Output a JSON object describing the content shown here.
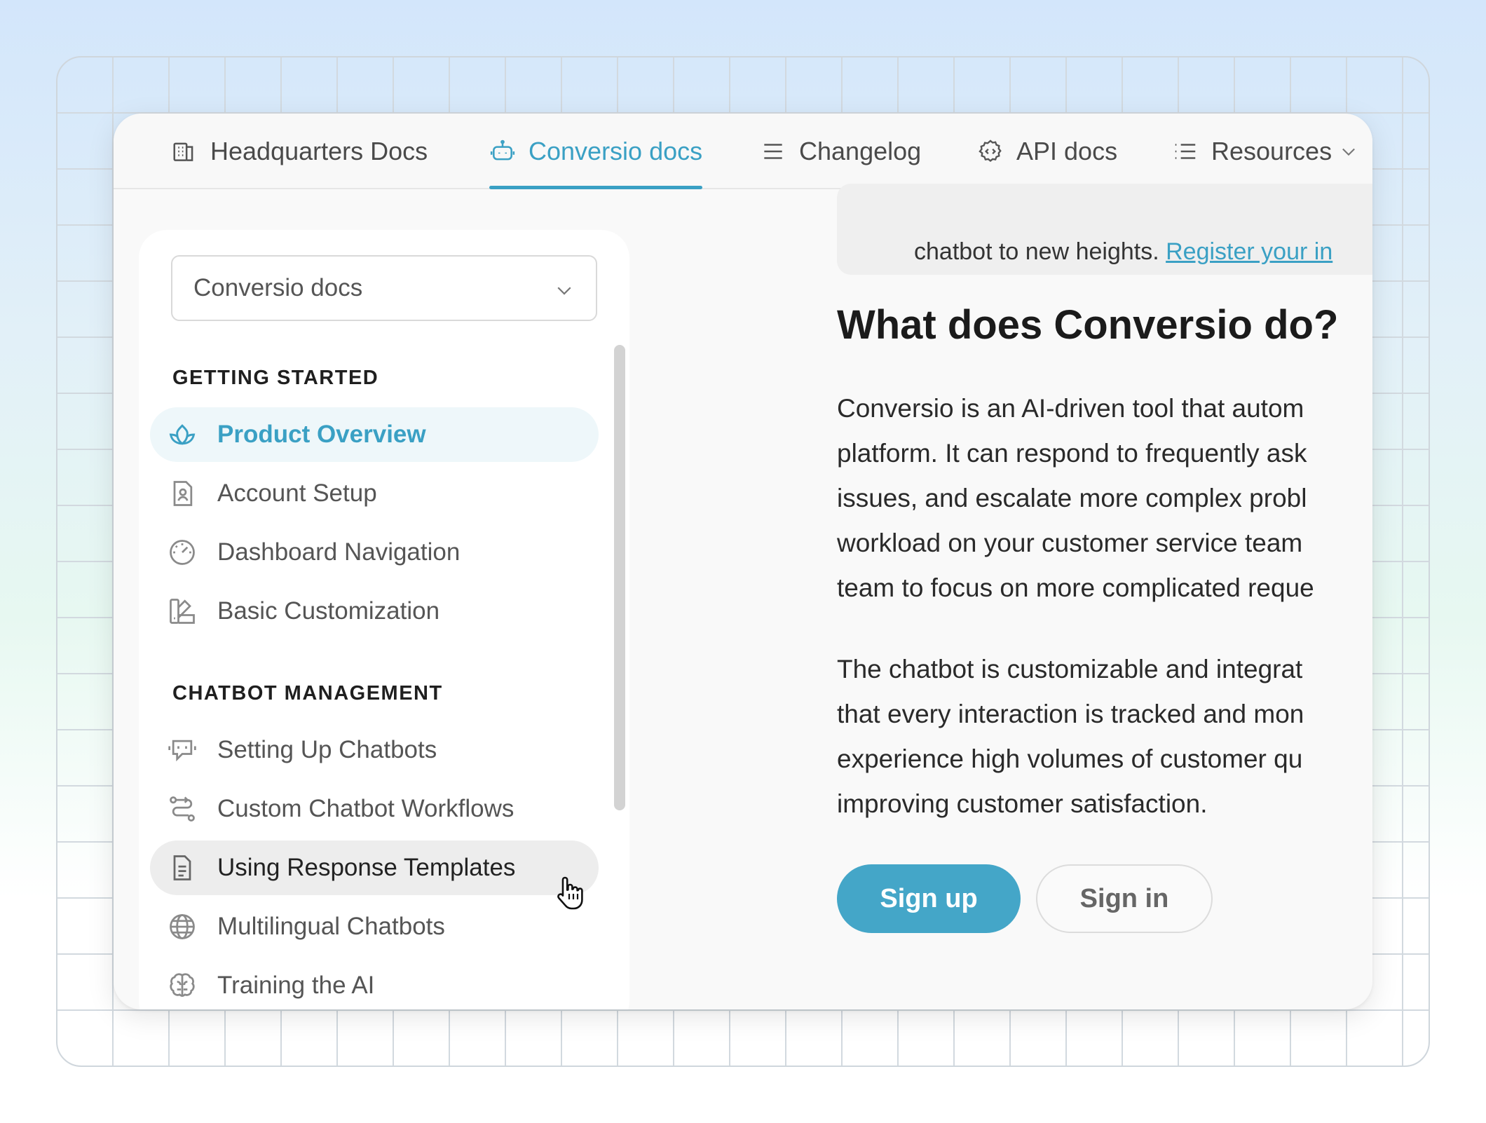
{
  "nav": {
    "tabs": [
      {
        "label": "Headquarters Docs",
        "icon": "building-icon"
      },
      {
        "label": "Conversio docs",
        "icon": "robot-icon",
        "active": true
      },
      {
        "label": "Changelog",
        "icon": "lines-icon"
      },
      {
        "label": "API docs",
        "icon": "api-gear-icon"
      },
      {
        "label": "Resources",
        "icon": "list-icon",
        "dropdown": true
      }
    ]
  },
  "sidebar": {
    "select_value": "Conversio docs",
    "sections": [
      {
        "title": "GETTING STARTED",
        "items": [
          {
            "label": "Product Overview",
            "icon": "lotus-icon",
            "state": "active"
          },
          {
            "label": "Account Setup",
            "icon": "user-document-icon"
          },
          {
            "label": "Dashboard Navigation",
            "icon": "gauge-icon"
          },
          {
            "label": "Basic Customization",
            "icon": "palette-icon"
          }
        ]
      },
      {
        "title": "CHATBOT MANAGEMENT",
        "items": [
          {
            "label": "Setting Up Chatbots",
            "icon": "chat-robot-icon"
          },
          {
            "label": "Custom Chatbot Workflows",
            "icon": "workflow-icon"
          },
          {
            "label": "Using Response Templates",
            "icon": "document-icon",
            "state": "hover"
          },
          {
            "label": "Multilingual Chatbots",
            "icon": "globe-icon"
          },
          {
            "label": "Training the AI",
            "icon": "brain-icon"
          }
        ]
      }
    ]
  },
  "content": {
    "banner_text": "chatbot to new heights. ",
    "banner_link": "Register your in",
    "heading": "What does Conversio do?",
    "paragraph1": [
      "Conversio is an AI-driven tool that autom",
      "platform. It can respond to frequently ask",
      "issues, and escalate more complex probl",
      "workload on your customer service team",
      "team to focus on more complicated reque"
    ],
    "paragraph2": [
      "The chatbot is customizable and integrat",
      "that every interaction is tracked and mon",
      "experience high volumes of customer qu",
      "improving customer satisfaction."
    ],
    "signup_label": "Sign up",
    "signin_label": "Sign in"
  },
  "colors": {
    "accent": "#3aa0c4",
    "button_primary": "#44a6c8",
    "active_item_bg": "#eef7fa",
    "hover_item_bg": "#ededed"
  }
}
